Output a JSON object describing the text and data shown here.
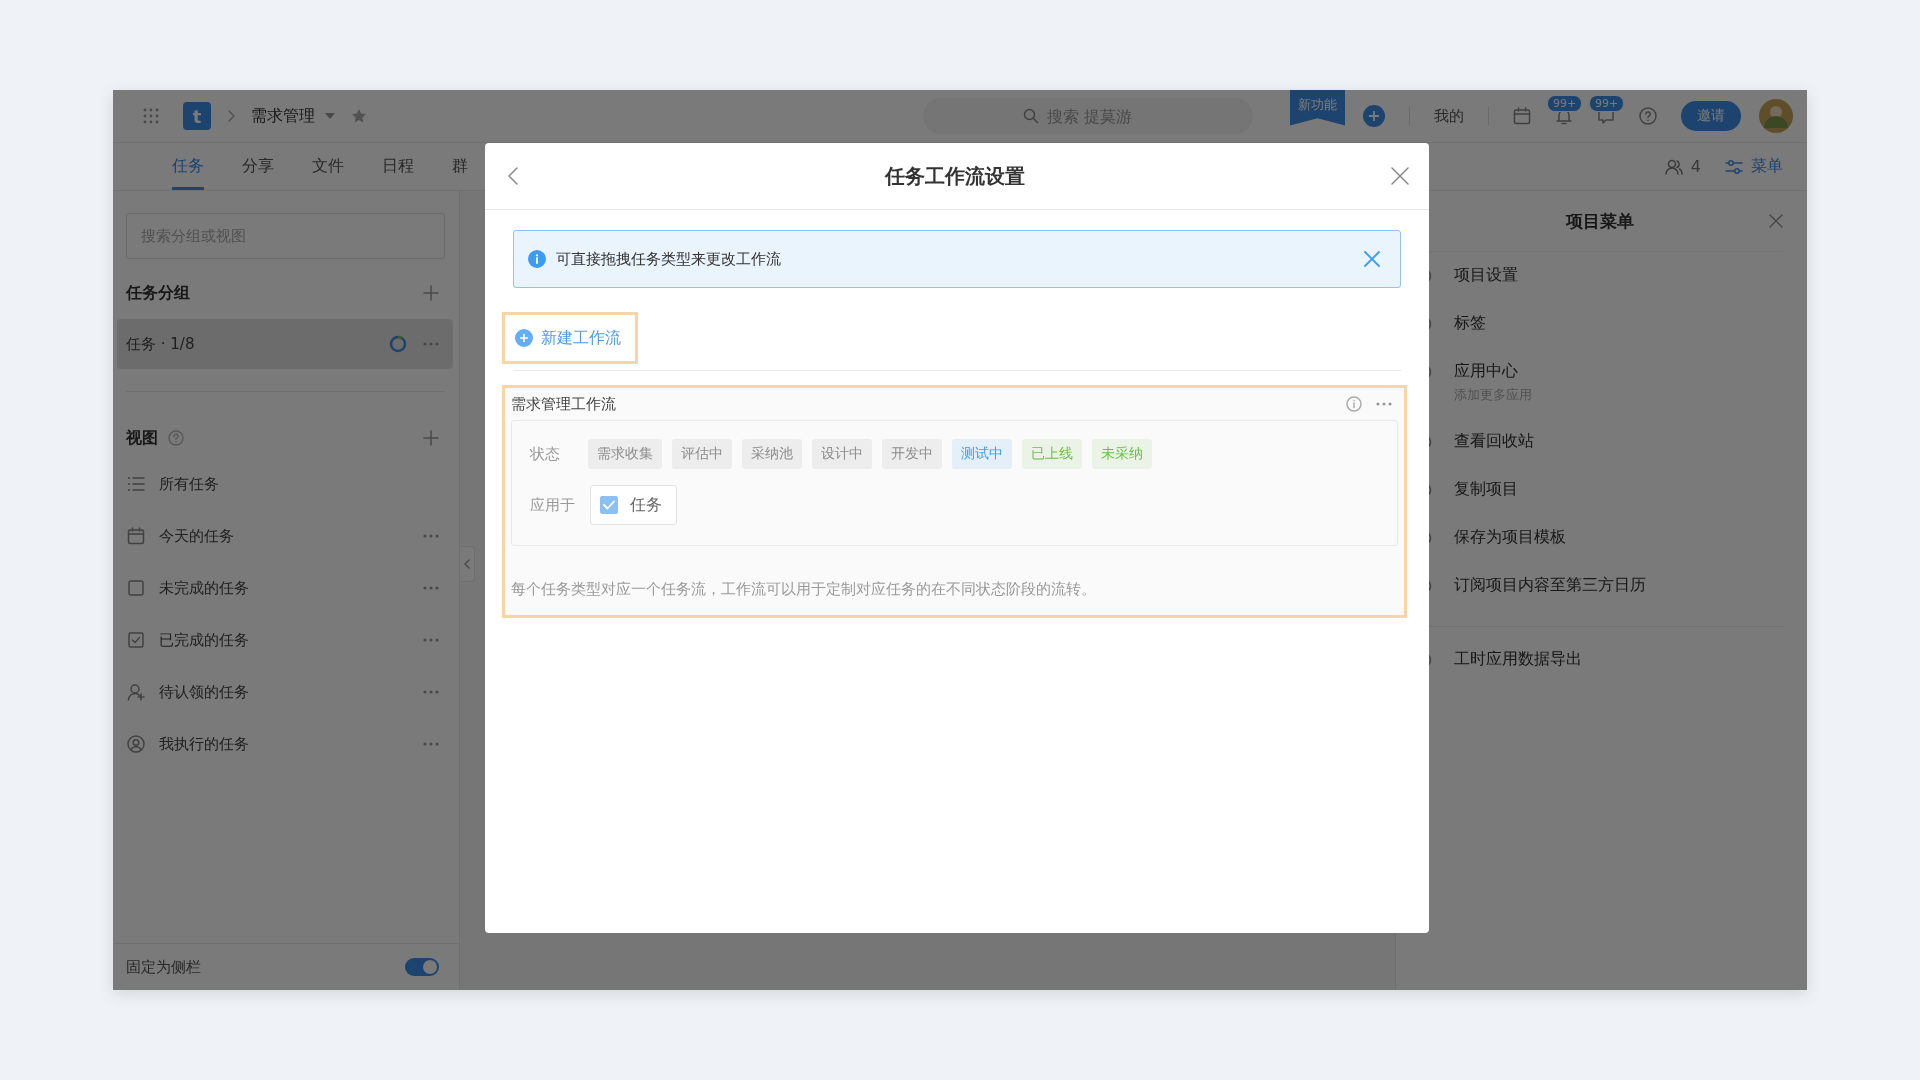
{
  "topbar": {
    "logo": "t",
    "project": "需求管理",
    "starred": true,
    "search": {
      "placeholder": "搜索 提莫游"
    },
    "new_feature_badge": "新功能",
    "my_link": "我的",
    "notifications": [
      {
        "count": "99+"
      },
      {
        "count": "99+"
      }
    ],
    "invite_button": "邀请"
  },
  "tabs": [
    {
      "label": "任务",
      "selected": true
    },
    {
      "label": "分享",
      "selected": false
    },
    {
      "label": "文件",
      "selected": false
    },
    {
      "label": "日程",
      "selected": false
    },
    {
      "label": "群",
      "selected": false
    }
  ],
  "header_actions": {
    "member_count": "4",
    "menu_label": "菜单"
  },
  "sidebar": {
    "search": {
      "placeholder": "搜索分组或视图"
    },
    "groups_title": "任务分组",
    "groups": [
      {
        "label": "任务 · 1/8",
        "selected": true
      }
    ],
    "views_title": "视图",
    "views": [
      {
        "label": "所有任务",
        "kind": "list",
        "has_menu": false
      },
      {
        "label": "今天的任务",
        "kind": "calendar",
        "has_menu": true
      },
      {
        "label": "未完成的任务",
        "kind": "box",
        "has_menu": true
      },
      {
        "label": "已完成的任务",
        "kind": "checked",
        "has_menu": true
      },
      {
        "label": "待认领的任务",
        "kind": "person",
        "has_menu": true
      },
      {
        "label": "我执行的任务",
        "kind": "user",
        "has_menu": true
      }
    ],
    "pin": {
      "label": "固定为侧栏",
      "on": true
    }
  },
  "project_menu": {
    "title": "项目菜单",
    "items": [
      {
        "label": "项目设置",
        "separated": false
      },
      {
        "label": "标签",
        "separated": false
      },
      {
        "label": "应用中心",
        "subtitle": "添加更多应用",
        "separated": false
      },
      {
        "label": "查看回收站",
        "separated": false
      },
      {
        "label": "复制项目",
        "separated": false
      },
      {
        "label": "保存为项目模板",
        "separated": false
      },
      {
        "label": "订阅项目内容至第三方日历",
        "separated": false
      },
      {
        "label": "工时应用数据导出",
        "separated": true
      }
    ]
  },
  "dialog": {
    "title": "任务工作流设置",
    "notice": "可直接拖拽任务类型来更改工作流",
    "new_button": {
      "label": "新建工作流",
      "highlighted": true
    },
    "workflows": [
      {
        "name": "需求管理工作流",
        "highlighted": true,
        "status_label": "状态",
        "statuses": [
          {
            "label": "需求收集",
            "color": "#8c8c8c"
          },
          {
            "label": "评估中",
            "color": "#8c8c8c"
          },
          {
            "label": "采纳池",
            "color": "#8c8c8c"
          },
          {
            "label": "设计中",
            "color": "#8c8c8c"
          },
          {
            "label": "开发中",
            "color": "#8c8c8c"
          },
          {
            "label": "测试中",
            "color": "#3d9bf0"
          },
          {
            "label": "已上线",
            "color": "#6cbf4a"
          },
          {
            "label": "未采纳",
            "color": "#6cbf4a"
          }
        ],
        "applies_label": "应用于",
        "applies_to": [
          {
            "label": "任务",
            "checked": true
          }
        ],
        "description": "每个任务类型对应一个任务流，工作流可以用于定制对应任务的在不同状态阶段的流转。"
      }
    ]
  }
}
